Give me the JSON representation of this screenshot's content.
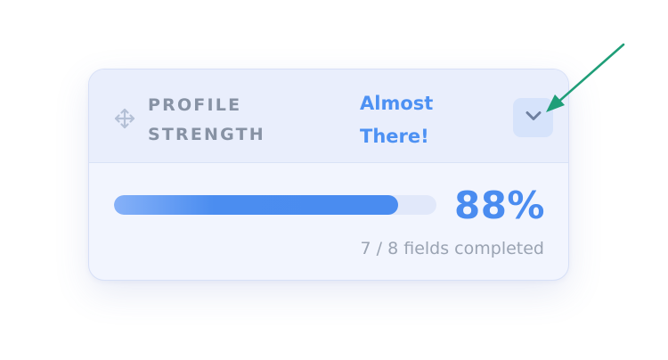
{
  "card": {
    "title_line1": "PROFILE",
    "title_line2": "STRENGTH",
    "status_line1": "Almost",
    "status_line2": "There!",
    "progress": 0.88,
    "percent_label": "88%",
    "fields_label": "7 / 8 fields completed"
  },
  "icons": {
    "drag": "move-icon",
    "toggle": "chevron-down-icon"
  },
  "colors": {
    "accent": "#4a8cf0",
    "title": "#8792a4",
    "muted": "#9aa3b2",
    "card_bg": "#f2f5fe",
    "header_bg": "#e9eefc",
    "annotation": "#1f9e78"
  }
}
